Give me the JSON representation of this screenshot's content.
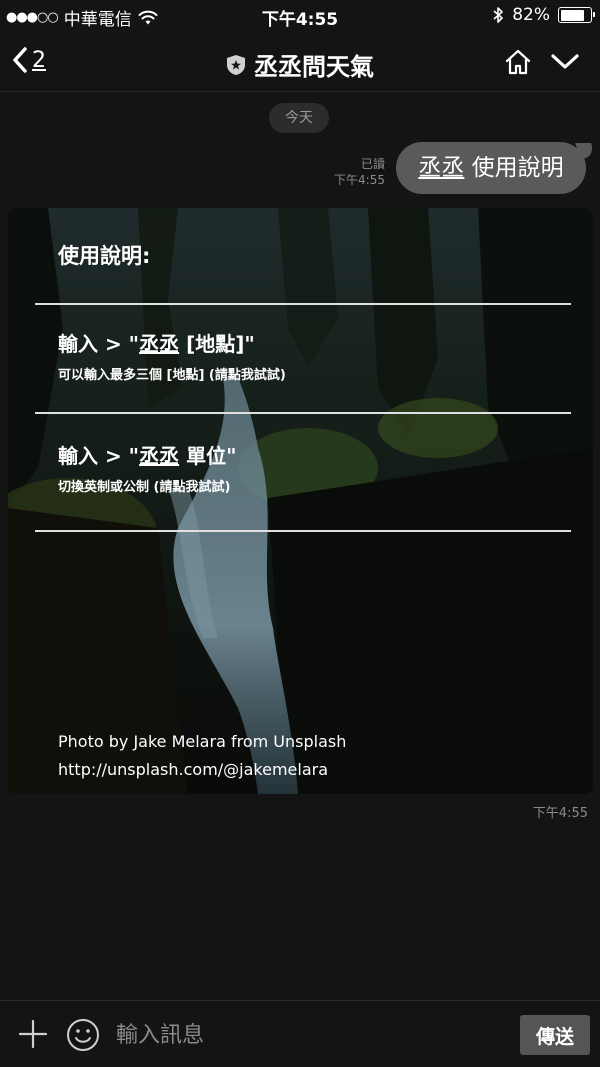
{
  "status_bar": {
    "signal": "●●●○○",
    "carrier": "中華電信",
    "time": "下午4:55",
    "battery": "82%",
    "battery_level": 0.82
  },
  "nav": {
    "back_count": "2",
    "title": "丞丞問天氣"
  },
  "chat": {
    "date_label": "今天",
    "outgoing": {
      "read_label": "已讀",
      "time": "下午4:55",
      "name": "丞丞",
      "text": " 使用說明"
    },
    "card": {
      "title": "使用說明:",
      "options": [
        {
          "prefix": "輸入 > \"",
          "keyword": "丞丞",
          "suffix": " [地點]\"",
          "sub": "可以輸入最多三個 [地點] (請點我試試)"
        },
        {
          "prefix": "輸入 > \"",
          "keyword": "丞丞",
          "suffix": " 單位\"",
          "sub": "切換英制或公制 (請點我試試)"
        }
      ],
      "credit_line1": "Photo by Jake Melara from Unsplash",
      "credit_line2": "http://unsplash.com/@jakemelara",
      "time": "下午4:55"
    }
  },
  "input_bar": {
    "placeholder": "輸入訊息",
    "send_label": "傳送"
  }
}
